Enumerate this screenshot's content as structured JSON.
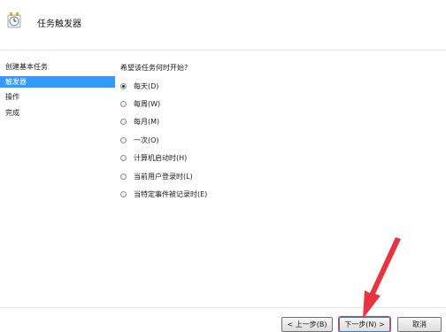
{
  "window": {
    "title": "任务触发器"
  },
  "colors": {
    "accent": "#3399ff",
    "annotation_arrow": "#e8343e"
  },
  "steps": [
    {
      "label": "创建基本任务",
      "active": false
    },
    {
      "label": "触发器",
      "active": true
    },
    {
      "label": "操作",
      "active": false
    },
    {
      "label": "完成",
      "active": false
    }
  ],
  "main": {
    "question": "希望该任务何时开始?",
    "options": [
      {
        "label": "每天(D)",
        "checked": true
      },
      {
        "label": "每周(W)",
        "checked": false
      },
      {
        "label": "每月(M)",
        "checked": false
      },
      {
        "label": "一次(O)",
        "checked": false
      },
      {
        "label": "计算机启动时(H)",
        "checked": false
      },
      {
        "label": "当前用户登录时(L)",
        "checked": false
      },
      {
        "label": "当特定事件被记录时(E)",
        "checked": false
      }
    ]
  },
  "footer": {
    "back_label": "< 上一步(B)",
    "next_label": "下一步(N) >",
    "cancel_label": "取消"
  },
  "icons": {
    "header": "task-scheduler-clock-icon"
  }
}
